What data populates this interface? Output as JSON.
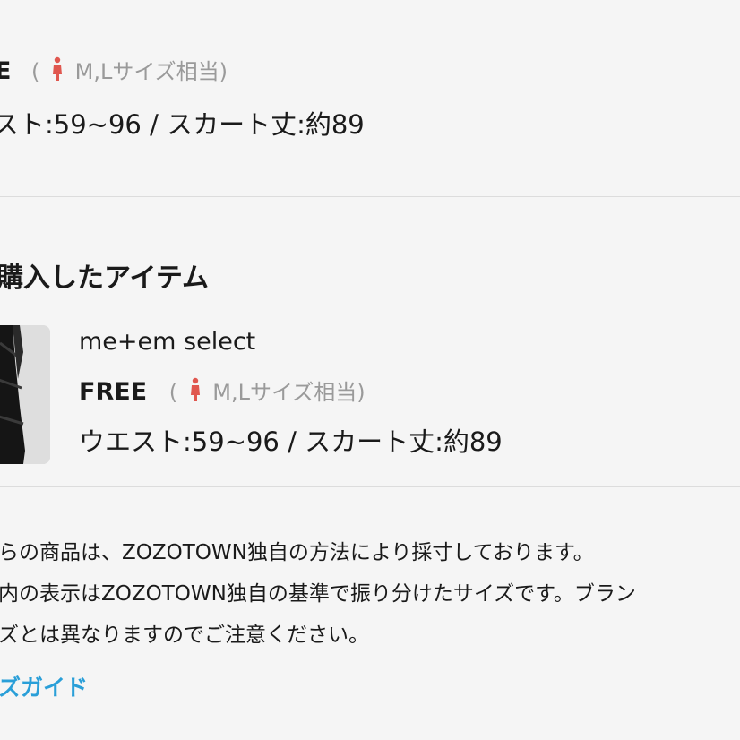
{
  "top_item": {
    "size_name": "E",
    "size_note_open": "(",
    "size_equiv": "M,Lサイズ相当)",
    "dimensions": "スト:59~96 / スカート丈:約89"
  },
  "purchased": {
    "section_title": "購入したアイテム",
    "brand": "me+em select",
    "size_name": "FREE",
    "size_note_open": "(",
    "size_equiv": "M,Lサイズ相当)",
    "dimensions": "ウエスト:59~96 / スカート丈:約89"
  },
  "notes": {
    "line1": "らの商品は、ZOZOTOWN独自の方法により採寸しております。",
    "line2": "内の表示はZOZOTOWN独自の基準で振り分けたサイズです。ブラン",
    "line3": "ズとは異なりますのでご注意ください。"
  },
  "size_guide_link": "ズガイド",
  "icons": {
    "person": "female-person-icon",
    "person_color": "#e0574f"
  },
  "colors": {
    "link": "#2a9fd8",
    "muted": "#9a9a9a",
    "background": "#f5f5f5"
  }
}
